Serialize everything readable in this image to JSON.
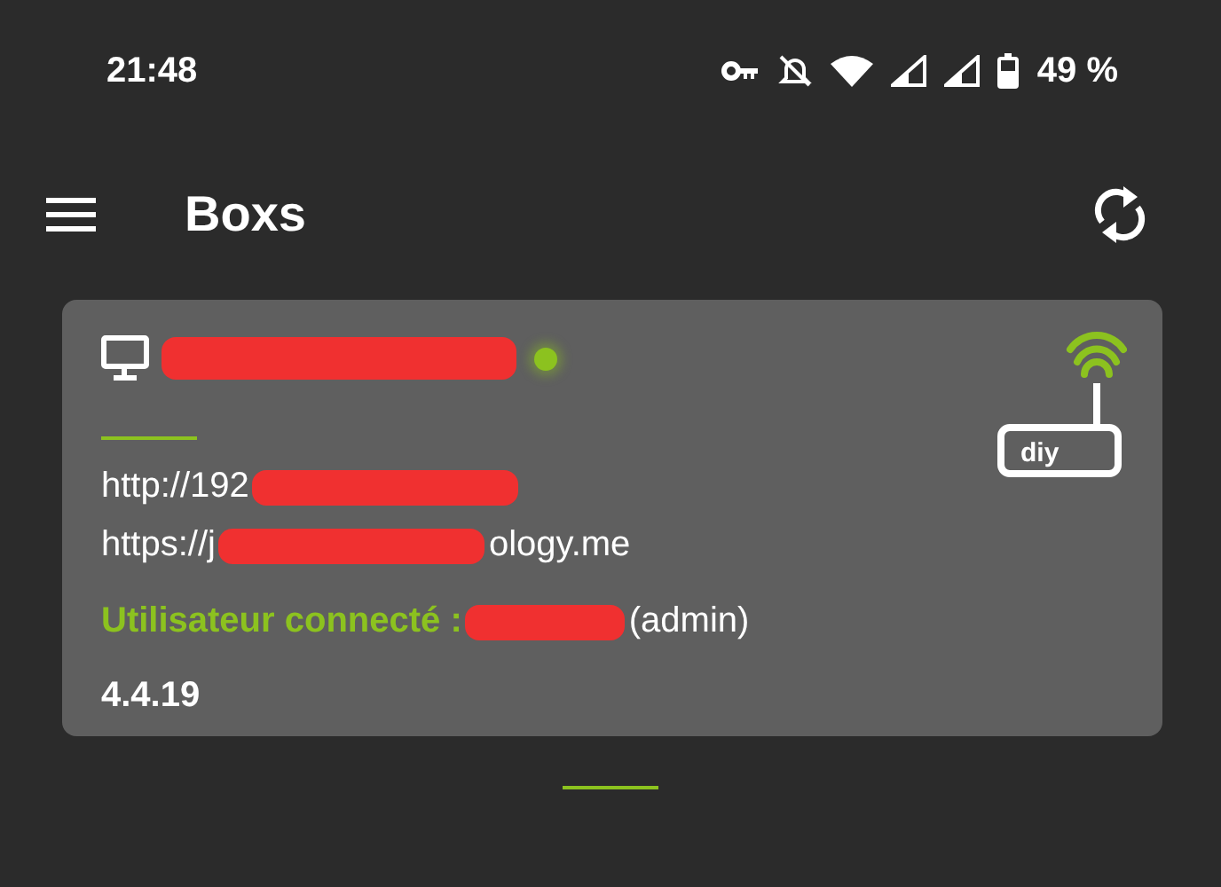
{
  "status_bar": {
    "time": "21:48",
    "battery": "49 %"
  },
  "app_bar": {
    "title": "Boxs"
  },
  "box": {
    "online": true,
    "router_label": "diy",
    "lines": [
      {
        "kind": "url",
        "before": "http://192"
      },
      {
        "kind": "url",
        "before": "https://j",
        "after": "ology.me"
      },
      {
        "kind": "user",
        "before": "Utilisateur connecté :",
        "after": "(admin)"
      }
    ],
    "version": "4.4.19"
  }
}
